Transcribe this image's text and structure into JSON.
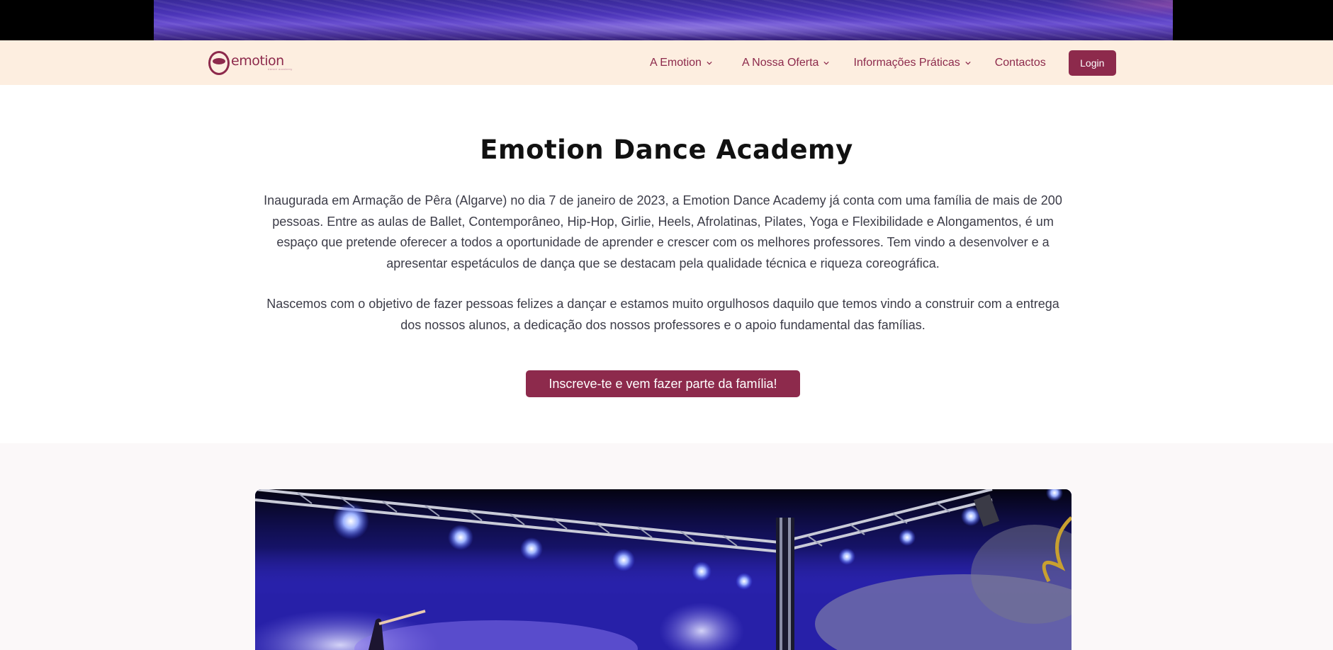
{
  "header": {
    "logo_text": "emotion",
    "logo_subtext": "dance academy"
  },
  "nav": {
    "items": [
      {
        "label": "A Emotion",
        "has_dropdown": true
      },
      {
        "label": "A Nossa Oferta",
        "has_dropdown": true
      },
      {
        "label": "Informações Práticas",
        "has_dropdown": true
      },
      {
        "label": "Contactos",
        "has_dropdown": false
      }
    ],
    "login_label": "Login"
  },
  "main": {
    "title": "Emotion Dance Academy",
    "paragraph1": "Inaugurada em Armação de Pêra (Algarve) no dia 7 de janeiro de 2023, a Emotion Dance Academy já conta com uma família de mais de 200 pessoas. Entre as aulas de Ballet, Contemporâneo, Hip-Hop, Girlie, Heels, Afrolatinas, Pilates, Yoga e Flexibilidade e Alongamentos, é um espaço que pretende oferecer a todos a oportunidade de aprender e crescer com os melhores professores. Tem vindo a desenvolver e a apresentar espetáculos de dança que se destacam pela qualidade técnica e riqueza coreográfica.",
    "paragraph2": "Nascemos com o objetivo de fazer pessoas felizes a dançar e estamos muito orgulhosos daquilo que temos vindo a construir com a entrega dos nossos alunos, a dedicação dos nossos professores e o apoio fundamental das famílias.",
    "cta_label": "Inscreve-te e vem fazer parte da família!"
  },
  "colors": {
    "brand": "#8d2a4c",
    "navbar_bg": "#fdeee0",
    "text": "#3c3c48",
    "section_bg": "#fbf8f9"
  },
  "icons": [
    "chevron-down-icon",
    "logo-icon"
  ]
}
